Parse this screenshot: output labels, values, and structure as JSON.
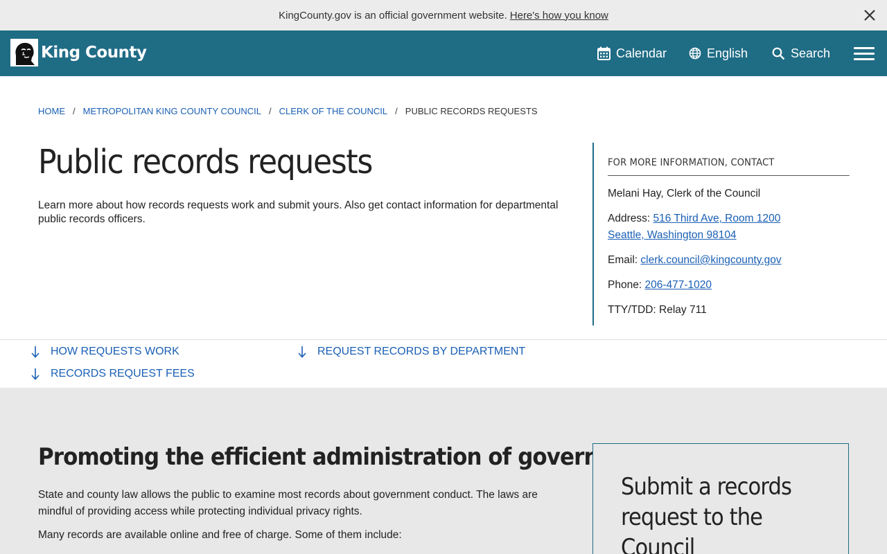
{
  "banner": {
    "text": "KingCounty.gov is an official government website.",
    "link": "Here's how you know",
    "close_icon": "close-icon"
  },
  "header": {
    "logo_text": "King County",
    "nav": [
      {
        "label": "Calendar",
        "icon": "calendar-icon"
      },
      {
        "label": "English",
        "icon": "globe-icon"
      },
      {
        "label": "Search",
        "icon": "search-icon"
      }
    ],
    "menu_icon": "hamburger-menu-icon"
  },
  "breadcrumb": [
    {
      "label": "Home"
    },
    {
      "label": "Metropolitan King County Council"
    },
    {
      "label": "Clerk of the Council"
    },
    {
      "label": "Public records requests"
    }
  ],
  "page": {
    "title": "Public records requests",
    "intro": "Learn more about how records requests work and submit yours. Also get contact information for departmental public records officers."
  },
  "contact": {
    "heading": "For more information, contact",
    "name": "Melani Hay, Clerk of the Council",
    "address_label": "Address:",
    "address_line1": "516 Third Ave, Room 1200",
    "address_line2": "Seattle, Washington 98104",
    "email_label": "Email:",
    "email": "clerk.council@kingcounty.gov",
    "phone_label": "Phone:",
    "phone": "206-477-1020",
    "tty": "TTY/TDD: Relay 711"
  },
  "anchors": [
    {
      "label": "How requests work",
      "icon": "arrow-down-icon"
    },
    {
      "label": "Request records by department",
      "icon": "arrow-down-icon"
    },
    {
      "label": "Records request fees",
      "icon": "arrow-down-icon"
    }
  ],
  "section": {
    "title": "Promoting the efficient administration of government",
    "p1": "State and county law allows the public to examine most records about government conduct. The laws are mindful of providing access while protecting individual privacy rights.",
    "p2": "Many records are available online and free of charge. Some of them include:",
    "submit_title": "Submit a records request to the Council"
  },
  "colors": {
    "header": "#1f6c85",
    "link": "#1a5fb4",
    "banner_bg": "#ececec",
    "section_bg": "#e8e8e8"
  }
}
